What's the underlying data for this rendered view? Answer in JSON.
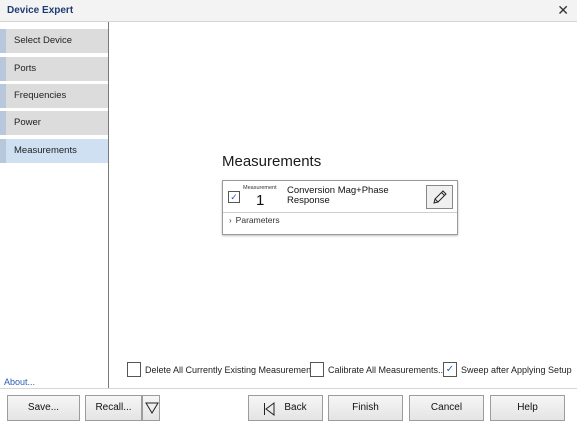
{
  "window": {
    "title": "Device Expert",
    "close_glyph": "✕"
  },
  "sidebar": {
    "items": [
      {
        "label": "Select Device",
        "active": false
      },
      {
        "label": "Ports",
        "active": false
      },
      {
        "label": "Frequencies",
        "active": false
      },
      {
        "label": "Power",
        "active": false
      },
      {
        "label": "Measurements",
        "active": true
      }
    ],
    "about_label": "About..."
  },
  "main": {
    "title": "Measurements",
    "measurements": [
      {
        "checked": true,
        "number_label": "Measurement",
        "number": "1",
        "name": "Conversion Mag+Phase Response",
        "edit_icon": "pencil-icon",
        "parameters_label": "Parameters"
      }
    ]
  },
  "options": {
    "delete_all_label": "Delete All Currently Existing Measurements",
    "delete_all_checked": false,
    "calibrate_all_label": "Calibrate All Measurements...",
    "calibrate_all_checked": false,
    "sweep_after_label": "Sweep after Applying Setup",
    "sweep_after_checked": true
  },
  "buttons": {
    "save": "Save...",
    "recall": "Recall...",
    "back": "Back",
    "finish": "Finish",
    "cancel": "Cancel",
    "help": "Help"
  },
  "colors": {
    "title_text": "#1f3b73",
    "nav_active": "#cfe0f3",
    "nav_inactive": "#dcdcdc",
    "link": "#2a5cb8"
  }
}
